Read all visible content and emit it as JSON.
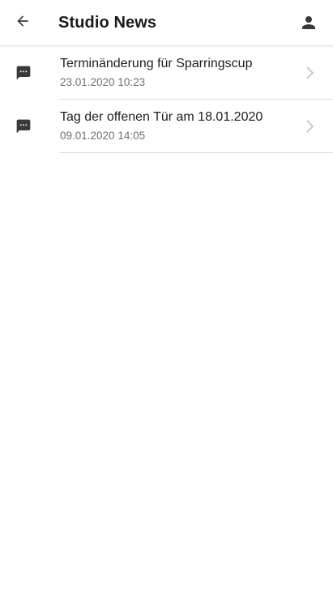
{
  "header": {
    "title": "Studio News",
    "back_icon": "arrow-left-icon",
    "profile_icon": "person-icon"
  },
  "news": {
    "items": [
      {
        "title": "Terminänderung für Sparringscup",
        "date": "23.01.2020 10:23",
        "icon": "message-icon"
      },
      {
        "title": "Tag der offenen Tür am 18.01.2020",
        "date": "09.01.2020 14:05",
        "icon": "message-icon"
      }
    ]
  },
  "colors": {
    "icon": "#3a3a3a",
    "chevron": "#c4c4c4",
    "divider": "#dcdcdc"
  }
}
